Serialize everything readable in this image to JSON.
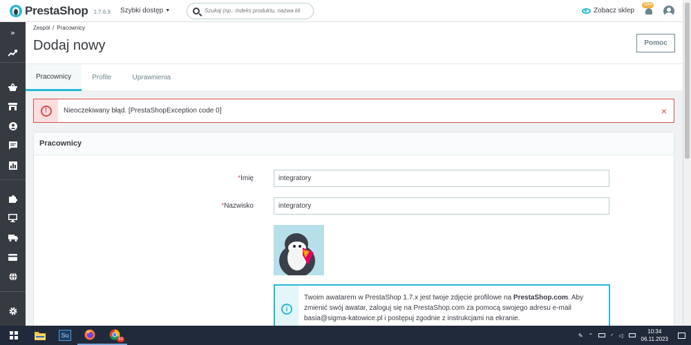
{
  "topbar": {
    "logo_text": "PrestaShop",
    "version": "1.7.6.9",
    "quick_access": "Szybki dostęp",
    "search_placeholder": "Szukaj (np.: indeks produktu, nazwa kli",
    "view_shop": "Zobacz sklep",
    "notifications_count": "2964"
  },
  "sidebar": {
    "items": [
      "collapse-icon",
      "stats-trend-icon",
      "orders-basket-icon",
      "catalog-store-icon",
      "customers-icon",
      "messages-icon",
      "stats-icon",
      "modules-puzzle-icon",
      "design-monitor-icon",
      "shipping-truck-icon",
      "payment-card-icon",
      "international-globe-icon",
      "settings-gear-icon"
    ]
  },
  "header": {
    "breadcrumb": [
      "Zespół",
      "/",
      "Pracownicy"
    ],
    "title": "Dodaj nowy",
    "help_button": "Pomoc",
    "tabs": [
      {
        "label": "Pracownicy",
        "active": true
      },
      {
        "label": "Profile",
        "active": false
      },
      {
        "label": "Uprawnienia",
        "active": false
      }
    ]
  },
  "alert": {
    "message": "Nieoczekiwany błąd. [PrestaShopException code 0]",
    "close": "×",
    "icon": "!"
  },
  "panel": {
    "title": "Pracownicy",
    "fields": [
      {
        "required_mark": "*",
        "label": "Imię",
        "value": "integratory"
      },
      {
        "required_mark": "*",
        "label": "Nazwisko",
        "value": "integratory"
      }
    ],
    "info": {
      "icon": "i",
      "text_before": "Twoim awatarem w PrestaShop 1.7.x jest twoje zdjęcie profilowe na ",
      "link": "PrestaShop.com",
      "text_after": ". Aby zmienić swój awatar, zaloguj się na PrestaShop.com za pomocą swojego adresu e-mail basia@sigma-katowice.pl i postępuj zgodnie z instrukcjami na ekranie."
    }
  },
  "taskbar": {
    "apps": [
      "file-explorer",
      "Su",
      "firefox",
      "chrome"
    ],
    "chrome_badge": "63",
    "time": "10:34",
    "date": "06.11.2023"
  },
  "colors": {
    "accent": "#25b9d7",
    "sidebar_bg": "#363a41",
    "danger": "#d94b4b",
    "danger_bg": "#fcdedf",
    "taskbar_bg": "#202a3a"
  }
}
